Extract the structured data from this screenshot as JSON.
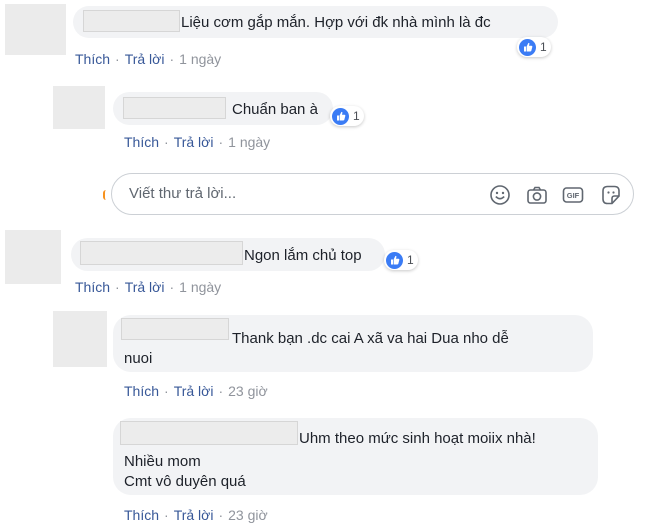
{
  "comments": [
    {
      "text": "Liệu cơm gắp mắn. Hợp với đk nhà mình là đc",
      "reaction_count": "1",
      "actions": {
        "like": "Thích",
        "reply": "Trả lời",
        "time": "1 ngày"
      },
      "replies": [
        {
          "text": "Chuẩn ban à",
          "reaction_count": "1",
          "actions": {
            "like": "Thích",
            "reply": "Trả lời",
            "time": "1 ngày"
          }
        }
      ],
      "reply_box": {
        "placeholder": "Viết thư trả lời..."
      }
    },
    {
      "text": "Ngon lắm chủ top",
      "reaction_count": "1",
      "actions": {
        "like": "Thích",
        "reply": "Trả lời",
        "time": "1 ngày"
      },
      "replies": [
        {
          "text_line1": "Thank bạn .dc cai A xã va hai Dua nho dễ",
          "text_line2": "nuoi",
          "actions": {
            "like": "Thích",
            "reply": "Trả lời",
            "time": "23 giờ"
          }
        },
        {
          "text_line1": "Uhm theo mức sinh hoạt moiix nhà!",
          "text_line2": "Nhiều mom",
          "text_line3": "Cmt vô duyên quá",
          "actions": {
            "like": "Thích",
            "reply": "Trả lời",
            "time": "23 giờ"
          }
        }
      ]
    }
  ],
  "colors": {
    "link": "#385898",
    "like_blue": "#3b7cf5",
    "bubble": "#f2f3f5"
  },
  "icons": [
    "like-icon",
    "emoji-icon",
    "camera-icon",
    "gif-icon",
    "sticker-icon"
  ]
}
